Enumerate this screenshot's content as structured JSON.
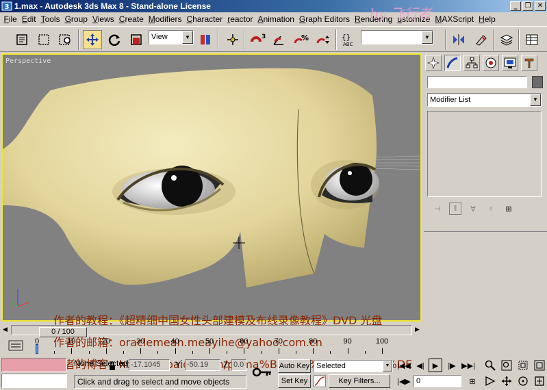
{
  "window": {
    "title": "1.max - Autodesk 3ds Max 8 - Stand-alone License",
    "controls": [
      "_",
      "❐",
      "✕"
    ]
  },
  "menu": [
    {
      "label": "File",
      "underline": "F",
      "rest": "ile"
    },
    {
      "label": "Edit",
      "underline": "E",
      "rest": "dit"
    },
    {
      "label": "Tools",
      "underline": "T",
      "rest": "ools"
    },
    {
      "label": "Group",
      "underline": "G",
      "rest": "roup"
    },
    {
      "label": "Views",
      "underline": "V",
      "rest": "iews"
    },
    {
      "label": "Create",
      "underline": "C",
      "rest": "reate"
    },
    {
      "label": "Modifiers",
      "underline": "M",
      "rest": "odifiers"
    },
    {
      "label": "Character",
      "underline": "C",
      "rest": "haracter"
    },
    {
      "label": "reactor",
      "underline": "r",
      "rest": "eactor"
    },
    {
      "label": "Animation",
      "underline": "A",
      "rest": "nimation"
    },
    {
      "label": "Graph Editors",
      "underline": "G",
      "rest": "raph Editors"
    },
    {
      "label": "Rendering",
      "underline": "R",
      "rest": "endering"
    },
    {
      "label": "Customize",
      "underline": "u",
      "rest": "stomize"
    },
    {
      "label": "MAXScript",
      "underline": "M",
      "rest": "AXScript"
    },
    {
      "label": "Help",
      "underline": "H",
      "rest": "elp"
    }
  ],
  "toolbar": {
    "refcoord_value": "View",
    "named_selection_value": "",
    "icons": [
      "select-icon",
      "region-select-icon",
      "select-by-name-icon",
      "move-icon",
      "rotate-icon",
      "scale-icon",
      "pivot-icon",
      "manipulate-icon",
      "snap-icon",
      "angle-snap-icon",
      "percent-snap-icon",
      "spinner-snap-icon",
      "edit-named-sel-icon",
      "mirror-icon",
      "align-icon",
      "layers-icon",
      "schematic-icon"
    ]
  },
  "viewport": {
    "label": "Perspective",
    "accent": "#f0e630",
    "background": "#818181"
  },
  "watermark": {
    "line1": "作者的教程：《超精细中国女性头部建模及布线录像教程》DVD 光盘",
    "line2": "作者的邮箱：oraclemean.meayihe@yahoo.com.cn",
    "line3": "作者的博客：http://hi.baidu.com/prima%B7%C9%D0%D0%D5%DE",
    "logo": "by 飞行者"
  },
  "command_panel": {
    "name_value": "",
    "modifier_list": "Modifier List",
    "tabs": [
      "create-tab-icon",
      "modify-tab-icon",
      "hierarchy-tab-icon",
      "motion-tab-icon",
      "display-tab-icon",
      "utilities-tab-icon"
    ],
    "stack_buttons": [
      "pin-stack-icon",
      "show-end-result-icon",
      "make-unique-icon",
      "remove-modifier-icon",
      "configure-sets-icon"
    ]
  },
  "timeline": {
    "slider_label": "0 / 100",
    "ticks": [
      "0",
      "10",
      "20",
      "30",
      "40",
      "50",
      "60",
      "70",
      "80",
      "90",
      "100"
    ],
    "ticks_values": [
      0,
      10,
      20,
      30,
      40,
      50,
      60,
      70,
      80,
      90,
      100
    ],
    "current_frame": 0,
    "frame_range": [
      0,
      100
    ]
  },
  "status": {
    "selection": "None Selected",
    "x_label": "X:",
    "x_value": "-17.1045",
    "y_label": "Y:",
    "y_value": "-50.19",
    "z_label": "Z:",
    "z_value": "0.0",
    "prompt": "Click and drag to select and move objects",
    "auto_key": "Auto Key",
    "set_key": "Set Key",
    "key_mode": "Selected",
    "key_filters": "Key Filters...",
    "frame_value": "0"
  }
}
